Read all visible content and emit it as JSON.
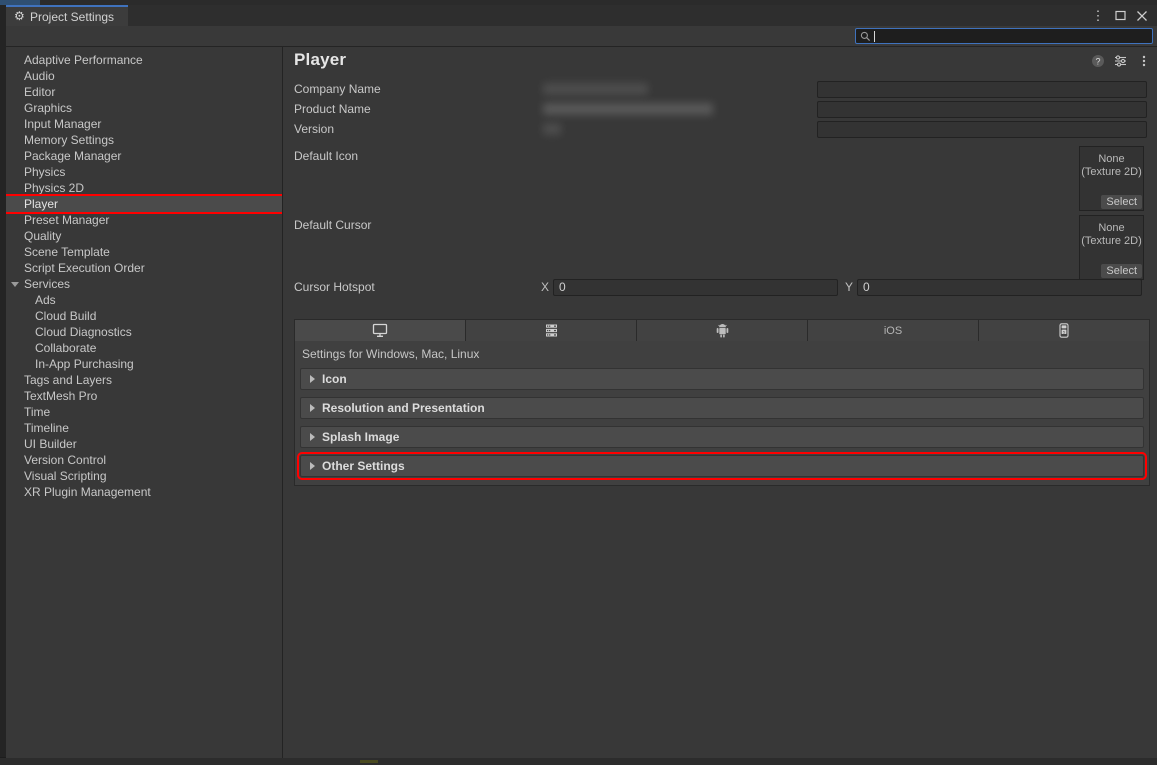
{
  "window": {
    "tab_label": "Project Settings",
    "tab_icon": "gear-icon",
    "buttons": {
      "kebab": "⋮",
      "maximize": "maximize-icon",
      "close": "close-icon"
    }
  },
  "search": {
    "icon": "search-icon",
    "value": "",
    "placeholder": ""
  },
  "sidebar": {
    "items": [
      {
        "label": "Adaptive Performance",
        "level": 0,
        "selected": false,
        "expander": ""
      },
      {
        "label": "Audio",
        "level": 0,
        "selected": false,
        "expander": ""
      },
      {
        "label": "Editor",
        "level": 0,
        "selected": false,
        "expander": ""
      },
      {
        "label": "Graphics",
        "level": 0,
        "selected": false,
        "expander": ""
      },
      {
        "label": "Input Manager",
        "level": 0,
        "selected": false,
        "expander": ""
      },
      {
        "label": "Memory Settings",
        "level": 0,
        "selected": false,
        "expander": ""
      },
      {
        "label": "Package Manager",
        "level": 0,
        "selected": false,
        "expander": ""
      },
      {
        "label": "Physics",
        "level": 0,
        "selected": false,
        "expander": ""
      },
      {
        "label": "Physics 2D",
        "level": 0,
        "selected": false,
        "expander": ""
      },
      {
        "label": "Player",
        "level": 0,
        "selected": true,
        "expander": "",
        "highlighted": true
      },
      {
        "label": "Preset Manager",
        "level": 0,
        "selected": false,
        "expander": ""
      },
      {
        "label": "Quality",
        "level": 0,
        "selected": false,
        "expander": ""
      },
      {
        "label": "Scene Template",
        "level": 0,
        "selected": false,
        "expander": ""
      },
      {
        "label": "Script Execution Order",
        "level": 0,
        "selected": false,
        "expander": ""
      },
      {
        "label": "Services",
        "level": 0,
        "selected": false,
        "expander": "expanded"
      },
      {
        "label": "Ads",
        "level": 1,
        "selected": false,
        "expander": ""
      },
      {
        "label": "Cloud Build",
        "level": 1,
        "selected": false,
        "expander": ""
      },
      {
        "label": "Cloud Diagnostics",
        "level": 1,
        "selected": false,
        "expander": ""
      },
      {
        "label": "Collaborate",
        "level": 1,
        "selected": false,
        "expander": ""
      },
      {
        "label": "In-App Purchasing",
        "level": 1,
        "selected": false,
        "expander": ""
      },
      {
        "label": "Tags and Layers",
        "level": 0,
        "selected": false,
        "expander": ""
      },
      {
        "label": "TextMesh Pro",
        "level": 0,
        "selected": false,
        "expander": ""
      },
      {
        "label": "Time",
        "level": 0,
        "selected": false,
        "expander": ""
      },
      {
        "label": "Timeline",
        "level": 0,
        "selected": false,
        "expander": ""
      },
      {
        "label": "UI Builder",
        "level": 0,
        "selected": false,
        "expander": ""
      },
      {
        "label": "Version Control",
        "level": 0,
        "selected": false,
        "expander": ""
      },
      {
        "label": "Visual Scripting",
        "level": 0,
        "selected": false,
        "expander": ""
      },
      {
        "label": "XR Plugin Management",
        "level": 0,
        "selected": false,
        "expander": ""
      }
    ]
  },
  "main": {
    "title": "Player",
    "header_icons": [
      {
        "name": "help-icon",
        "glyph": "?"
      },
      {
        "name": "preset-icon",
        "glyph": "preset"
      },
      {
        "name": "more-menu-icon",
        "glyph": "⋮"
      }
    ],
    "fields": [
      {
        "label": "Company Name",
        "value": "",
        "redacted": true
      },
      {
        "label": "Product Name",
        "value": "",
        "redacted": true
      },
      {
        "label": "Version",
        "value": "",
        "redacted": true
      }
    ],
    "icon_slots": [
      {
        "label": "Default Icon",
        "slot_line1": "None",
        "slot_line2": "(Texture 2D)",
        "select_label": "Select"
      },
      {
        "label": "Default Cursor",
        "slot_line1": "None",
        "slot_line2": "(Texture 2D)",
        "select_label": "Select"
      }
    ],
    "cursor_hotspot": {
      "label": "Cursor Hotspot",
      "x_label": "X",
      "x_value": "0",
      "y_label": "Y",
      "y_value": "0"
    },
    "platform_tabs": [
      {
        "name": "standalone-tab",
        "icon": "desktop-icon",
        "label": "",
        "active": true
      },
      {
        "name": "dedicated-server-tab",
        "icon": "server-icon",
        "label": "",
        "active": false
      },
      {
        "name": "android-tab",
        "icon": "android-icon",
        "label": "",
        "active": false
      },
      {
        "name": "ios-tab",
        "icon": "",
        "label": "iOS",
        "active": false
      },
      {
        "name": "tvos-tab",
        "icon": "tvos-icon",
        "label": "",
        "active": false
      }
    ],
    "settings_for": "Settings for Windows, Mac, Linux",
    "foldouts": [
      {
        "label": "Icon",
        "expanded": false,
        "highlighted": false
      },
      {
        "label": "Resolution and Presentation",
        "expanded": false,
        "highlighted": false
      },
      {
        "label": "Splash Image",
        "expanded": false,
        "highlighted": false
      },
      {
        "label": "Other Settings",
        "expanded": false,
        "highlighted": true
      }
    ]
  },
  "colors": {
    "accent_blue": "#3f72bd",
    "highlight_red": "#ff0000",
    "panel_bg": "#383838",
    "field_bg": "#333333",
    "foldout_bg": "#4b4b4b"
  }
}
